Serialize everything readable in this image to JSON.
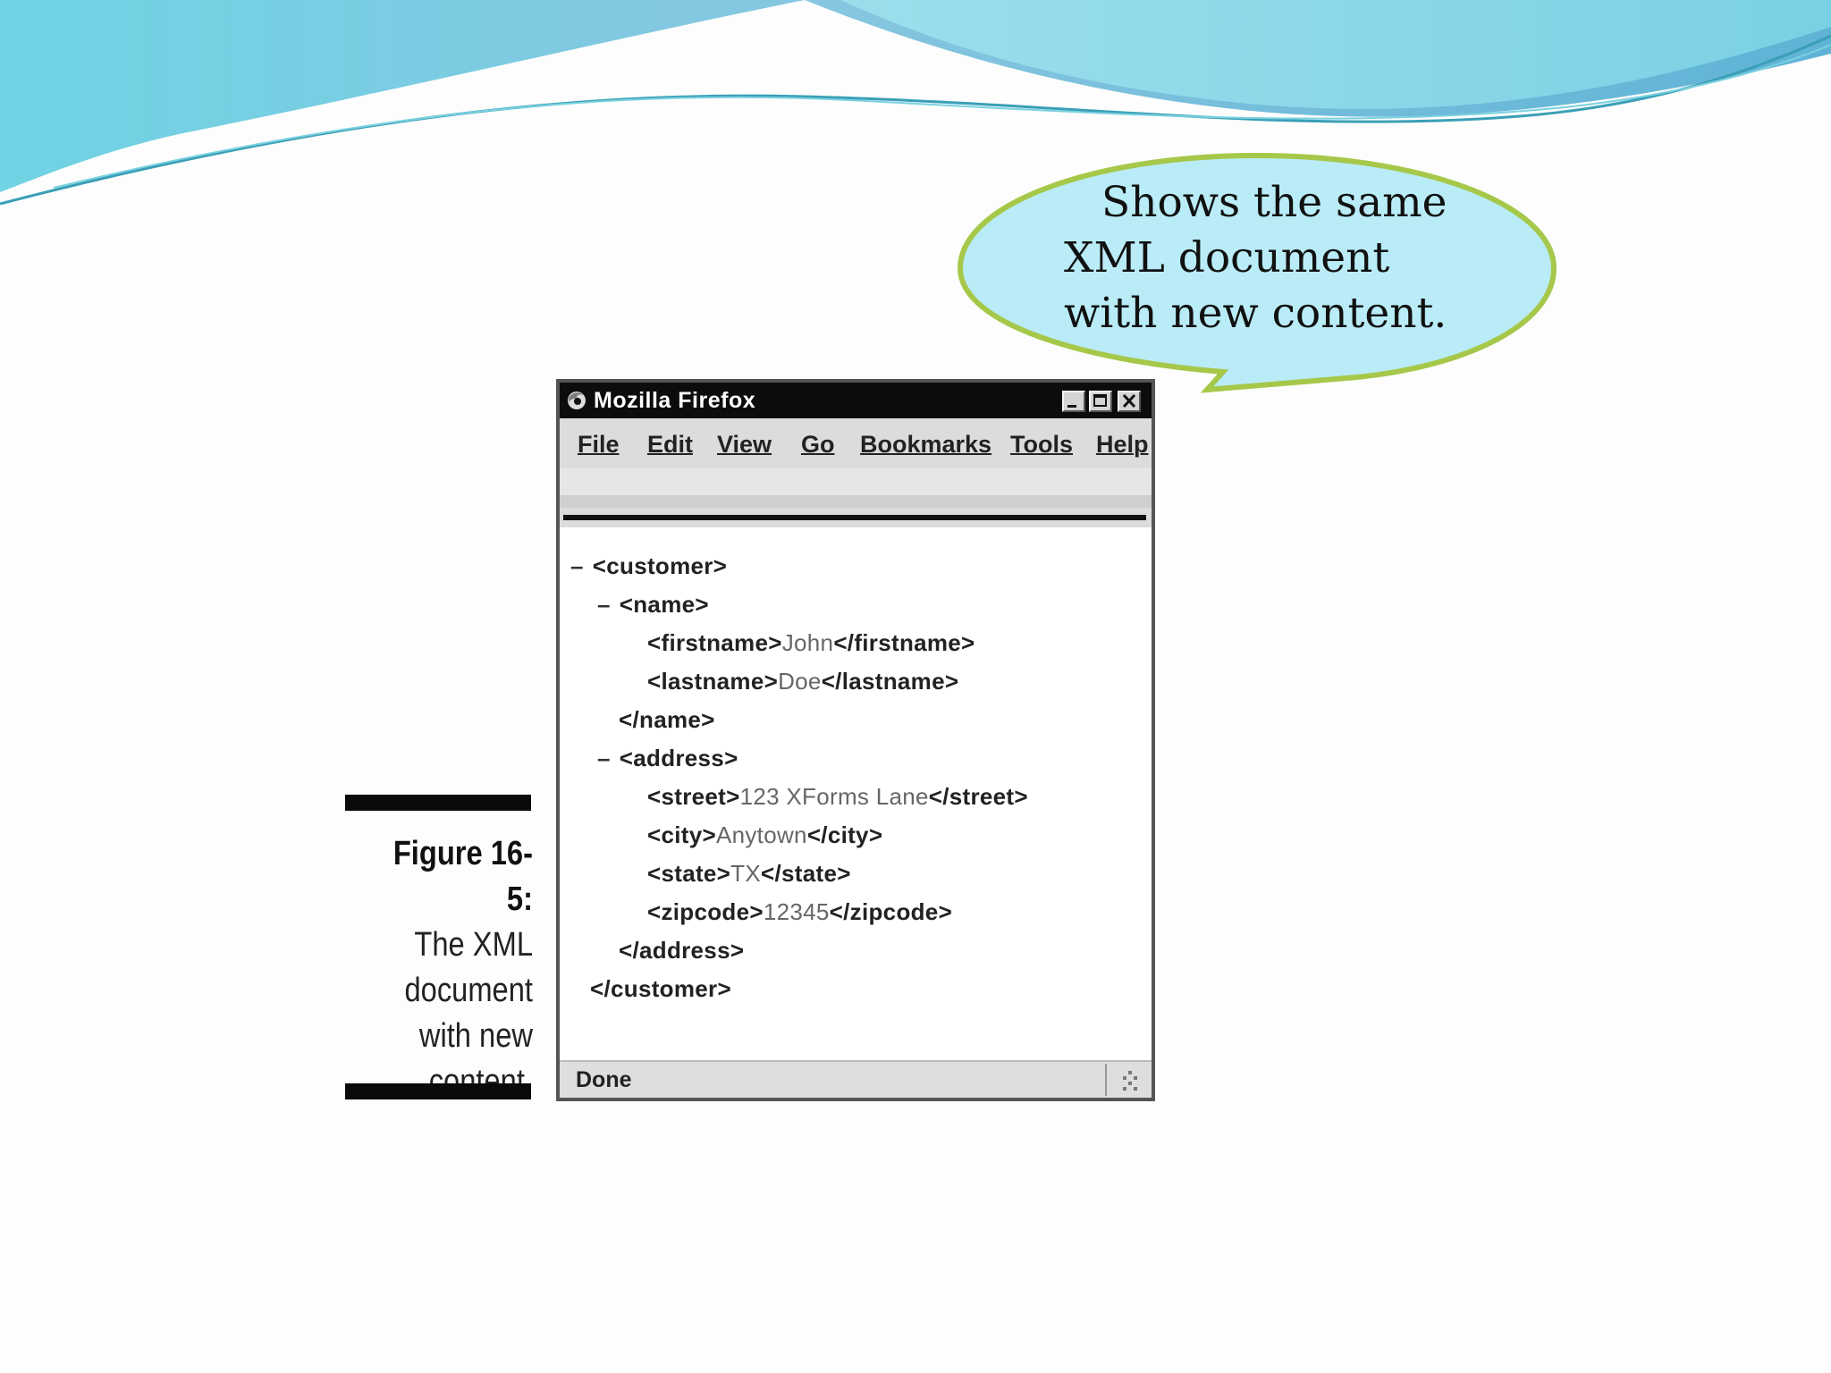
{
  "slide": {
    "callout_lines": [
      "Shows the same",
      "XML document",
      "with new content."
    ],
    "figure_number": "Figure 16-5:",
    "figure_caption_lines": [
      "The XML",
      "document",
      "with new",
      "content."
    ],
    "colors": {
      "wave_primary": "#6fc4dc",
      "wave_accent": "#7fd6e6",
      "callout_fill": "#b9ecf7",
      "callout_border": "#a6c84a"
    }
  },
  "window": {
    "title": "Mozilla Firefox",
    "icon": "firefox-icon",
    "controls": [
      "minimize-icon",
      "maximize-icon",
      "close-icon"
    ]
  },
  "menubar": {
    "items": [
      "File",
      "Edit",
      "View",
      "Go",
      "Bookmarks",
      "Tools",
      "Help"
    ]
  },
  "xml": {
    "lines": [
      {
        "toggle": "–",
        "open": "<customer>"
      },
      {
        "toggle": "–",
        "open": "<name>"
      },
      {
        "open": "<firstname>",
        "value": "John",
        "close": "</firstname>"
      },
      {
        "open": "<lastname>",
        "value": "Doe",
        "close": "</lastname>"
      },
      {
        "open": "</name>"
      },
      {
        "toggle": "–",
        "open": "<address>"
      },
      {
        "open": "<street>",
        "value": "123 XForms Lane",
        "close": "</street>"
      },
      {
        "open": "<city>",
        "value": "Anytown",
        "close": "</city>"
      },
      {
        "open": "<state>",
        "value": "TX",
        "close": "</state>"
      },
      {
        "open": "<zipcode>",
        "value": "12345",
        "close": "</zipcode>"
      },
      {
        "open": "</address>"
      },
      {
        "open": "</customer>"
      }
    ]
  },
  "status": {
    "text": "Done",
    "icon": "resize-grip-icon"
  }
}
